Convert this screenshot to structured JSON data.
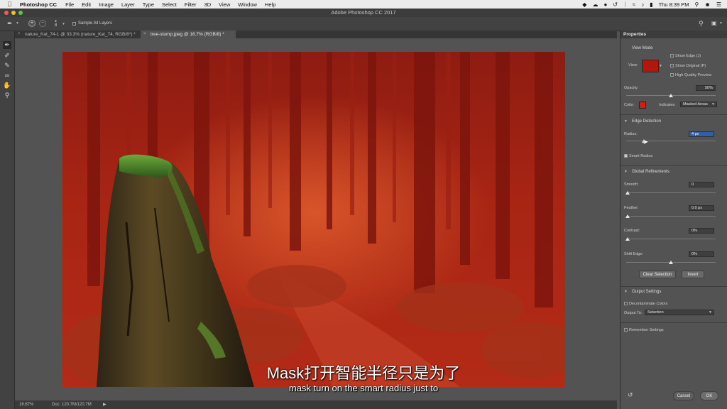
{
  "menubar": {
    "app": "Photoshop CC",
    "items": [
      "File",
      "Edit",
      "Image",
      "Layer",
      "Type",
      "Select",
      "Filter",
      "3D",
      "View",
      "Window",
      "Help"
    ],
    "clock": "Thu 8:39 PM"
  },
  "window": {
    "title": "Adobe Photoshop CC 2017"
  },
  "options": {
    "brush_size": "8",
    "sample_all_layers": "Sample All Layers"
  },
  "tabs": [
    {
      "label": "nature_Kat_74-1 @ 33.3% (nature_Kat_74, RGB/8*) *"
    },
    {
      "label": "tree-stump.jpeg @ 16.7% (RGB/8) *"
    }
  ],
  "status": {
    "zoom": "16.67%",
    "doc": "Doc: 120.7M/120.7M"
  },
  "properties": {
    "title": "Properties",
    "view_mode": {
      "title": "View Mode",
      "view_label": "View:",
      "show_edge": "Show Edge (J)",
      "show_original": "Show Original (P)",
      "high_quality": "High Quality Preview"
    },
    "opacity": {
      "label": "Opacity:",
      "value": "50%",
      "fraction": 0.5
    },
    "color": {
      "label": "Color:",
      "swatch": "#e0180f",
      "indicates_label": "Indicates:",
      "indicates_value": "Masked Areas"
    },
    "edge_detection": {
      "title": "Edge Detection",
      "radius_label": "Radius:",
      "radius_value": "4 px",
      "smart_radius": "Smart Radius"
    },
    "global_refinements": {
      "title": "Global Refinements",
      "smooth": {
        "label": "Smooth:",
        "value": "0"
      },
      "feather": {
        "label": "Feather:",
        "value": "0.0 px"
      },
      "contrast": {
        "label": "Contrast:",
        "value": "0%"
      },
      "shift_edge": {
        "label": "Shift Edge:",
        "value": "0%"
      }
    },
    "clear_selection": "Clear Selection",
    "invert": "Invert",
    "output": {
      "title": "Output Settings",
      "decontaminate": "Decontaminate Colors",
      "output_to_label": "Output To:",
      "output_to_value": "Selection"
    },
    "remember": "Remember Settings",
    "cancel": "Cancel",
    "ok": "OK"
  },
  "subtitles": {
    "line1": "Mask打开智能半径只是为了",
    "line2": "mask turn on the smart radius just to"
  },
  "colors": {
    "mask_overlay": "#b0180e",
    "accent": "#e0180f"
  }
}
